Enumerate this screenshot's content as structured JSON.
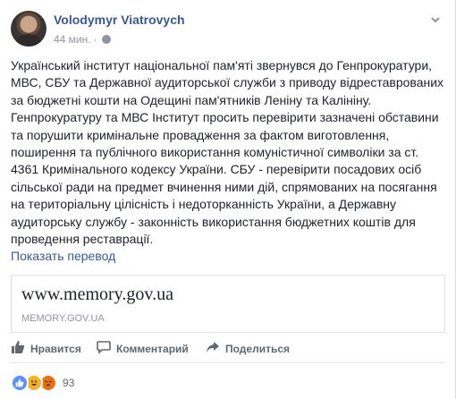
{
  "post": {
    "author": "Volodymyr Viatrovych",
    "time": "44 мин.",
    "text": "Український інститут національної пам'яті звернувся до Генпрокуратури,\nМВС, СБУ та Державної аудиторської служби з приводу відреставрованих\nза бюджетні кошти на Одещині пам'ятників Леніну та Калініну.\nГенпрокуратуру та МВС Інститут просить перевірити зазначені обставини\nта порушити кримінальне провадження за фактом виготовлення,\nпоширення та публічного використання комуністичної символіки за ст.\n4361 Кримінального кодексу України. СБУ - перевірити посадових осіб\nсільської ради на предмет вчинення ними дій, спрямованих на посягання\nна територіальну цілісність і недоторканність України, а Державну\nаудиторську службу - законність використання бюджетних коштів для\nпроведення реставрації.",
    "translate_link": "Показать перевод"
  },
  "link_preview": {
    "title": "www.memory.gov.ua",
    "domain": "MEMORY.GOV.UA"
  },
  "actions": {
    "like": "Нравится",
    "comment": "Комментарий",
    "share": "Поделиться"
  },
  "reactions": {
    "count": "93",
    "icons": [
      "like-icon",
      "haha-icon",
      "angry-icon"
    ]
  },
  "colors": {
    "link": "#365899",
    "meta": "#90949c",
    "text": "#1d2129",
    "like": "#5890ff"
  }
}
